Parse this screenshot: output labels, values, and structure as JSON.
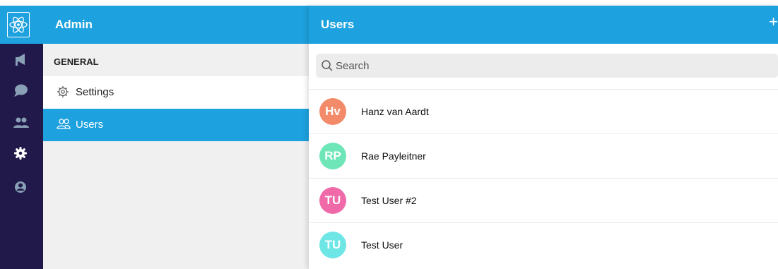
{
  "rail": {
    "items": [
      {
        "icon": "megaphone-icon"
      },
      {
        "icon": "chat-bubble-icon"
      },
      {
        "icon": "people-icon"
      },
      {
        "icon": "gear-icon"
      },
      {
        "icon": "user-circle-icon"
      }
    ],
    "logo_icon": "atom-icon"
  },
  "sidebar": {
    "title": "Admin",
    "section": "GENERAL",
    "items": [
      {
        "label": "Settings",
        "icon": "gear-outline-icon",
        "selected": false
      },
      {
        "label": "Users",
        "icon": "people-outline-icon",
        "selected": true
      }
    ]
  },
  "panel": {
    "title": "Users",
    "add_label": "+",
    "search_placeholder": "Search",
    "users": [
      {
        "initials": "Hv",
        "name": "Hanz van Aardt",
        "color": "#f38a6a"
      },
      {
        "initials": "RP",
        "name": "Rae Payleitner",
        "color": "#6ee6b8"
      },
      {
        "initials": "TU",
        "name": "Test User #2",
        "color": "#f06aaa"
      },
      {
        "initials": "TU",
        "name": "Test User",
        "color": "#6ee6e6"
      }
    ]
  },
  "colors": {
    "accent": "#1ea1df",
    "rail": "#21194a",
    "sidebar_bg": "#f0f0f0"
  }
}
